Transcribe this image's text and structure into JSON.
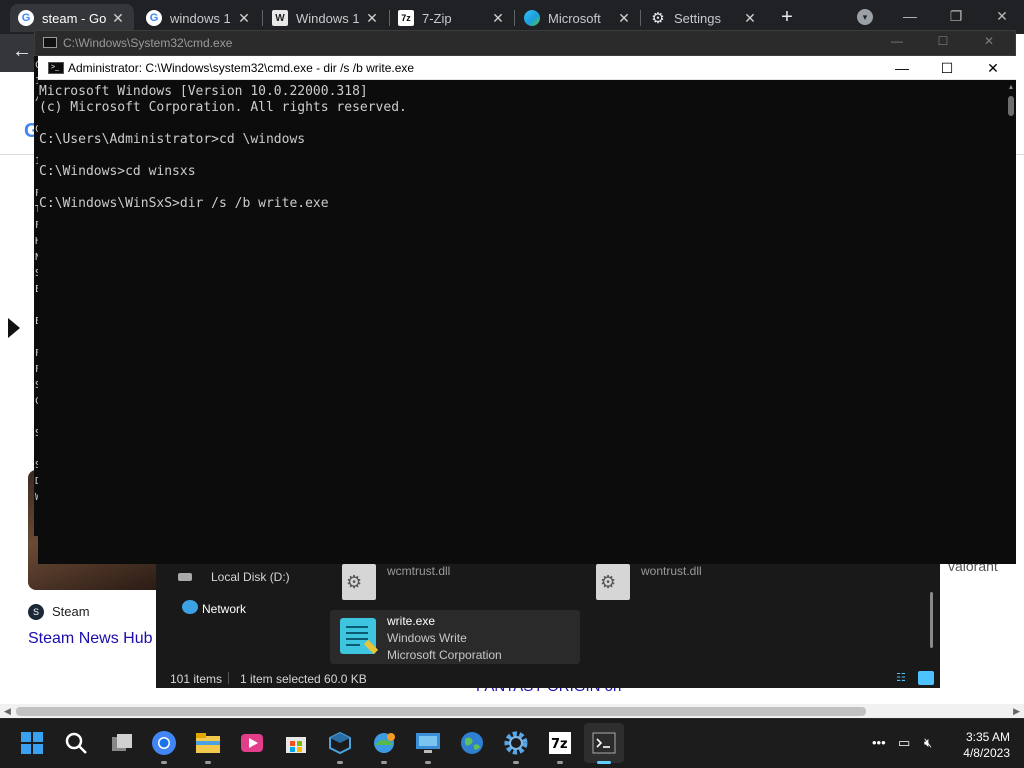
{
  "browser": {
    "tabs": [
      {
        "title": "steam - Go",
        "icon": "google-icon",
        "active": true
      },
      {
        "title": "windows 1",
        "icon": "google-icon",
        "active": false
      },
      {
        "title": "Windows 1",
        "icon": "wikipedia-icon",
        "active": false
      },
      {
        "title": "7-Zip",
        "icon": "7zip-icon",
        "active": false
      },
      {
        "title": "Microsoft",
        "icon": "edge-icon",
        "active": false
      },
      {
        "title": "Settings",
        "icon": "gear-icon",
        "active": false
      }
    ],
    "close_glyph": "✕",
    "new_tab_glyph": "+",
    "window_buttons": {
      "minimize": "—",
      "maximize": "❐",
      "close": "✕"
    }
  },
  "webpage": {
    "steam_source": "Steam",
    "steam_news_link": "Steam News Hub",
    "right_snippet": "valorant",
    "bottom_snippet": "FANTASY ORIGIN on"
  },
  "cmd_outer": {
    "title": "C:\\Windows\\System32\\cmd.exe",
    "left_chars": [
      "C",
      "1",
      "/",
      "",
      "C",
      "",
      "1",
      "",
      "F",
      "T",
      "F",
      "H",
      "N",
      "S",
      "E",
      "",
      "E",
      "",
      "F",
      "F",
      "S",
      "C",
      "",
      "S",
      "",
      "S",
      "D",
      "W"
    ]
  },
  "cmd": {
    "title": "Administrator: C:\\Windows\\system32\\cmd.exe - dir  /s /b write.exe",
    "lines": [
      "Microsoft Windows [Version 10.0.22000.318]",
      "(c) Microsoft Corporation. All rights reserved.",
      "",
      "C:\\Users\\Administrator>cd \\windows",
      "",
      "C:\\Windows>cd winsxs",
      "",
      "C:\\Windows\\WinSxS>dir /s /b write.exe"
    ]
  },
  "explorer": {
    "nav": {
      "local_disk": "Local Disk (D:)",
      "network": "Network"
    },
    "files": [
      {
        "name": "wcmtrust.dll"
      },
      {
        "name": "wontrust.dll"
      }
    ],
    "selected_file": {
      "name": "write.exe",
      "description": "Windows Write",
      "company": "Microsoft Corporation"
    },
    "status": {
      "item_count": "101 items",
      "selection": "1 item selected  60.0 KB"
    }
  },
  "taskbar": {
    "apps": [
      "start-icon",
      "search-icon",
      "task-view-icon",
      "chrome-icon",
      "file-explorer-icon",
      "media-player-icon",
      "microsoft-store-icon",
      "virtualbox-icon",
      "network-globe-icon",
      "remote-desktop-icon",
      "globe-icon",
      "settings-icon",
      "7zip-icon",
      "terminal-icon"
    ],
    "time": "3:35 AM",
    "date": "4/8/2023"
  }
}
